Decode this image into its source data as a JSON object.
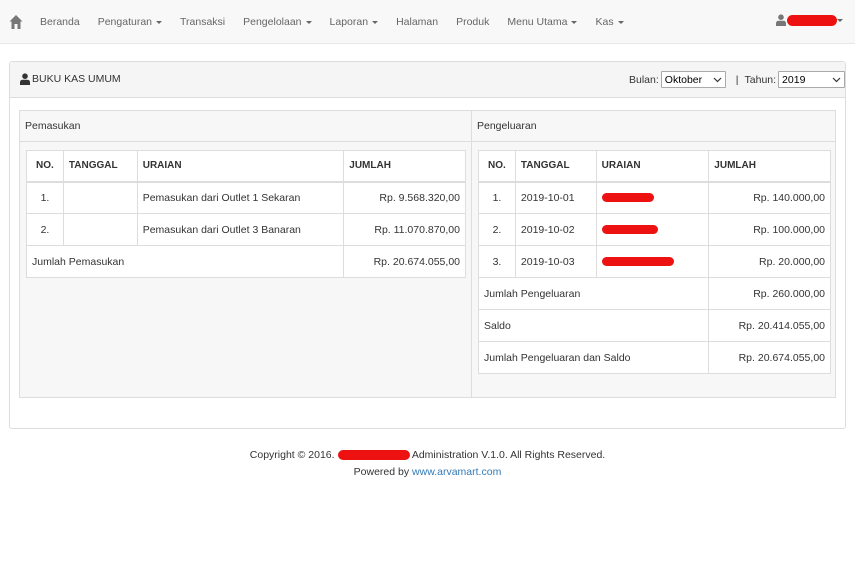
{
  "navbar": {
    "items": [
      {
        "label": "Beranda",
        "dropdown": false
      },
      {
        "label": "Pengaturan",
        "dropdown": true
      },
      {
        "label": "Transaksi",
        "dropdown": false
      },
      {
        "label": "Pengelolaan",
        "dropdown": true
      },
      {
        "label": "Laporan",
        "dropdown": true
      },
      {
        "label": "Halaman",
        "dropdown": false
      },
      {
        "label": "Produk",
        "dropdown": false
      },
      {
        "label": "Menu Utama",
        "dropdown": true
      },
      {
        "label": "Kas",
        "dropdown": true
      }
    ]
  },
  "panel": {
    "title": "BUKU KAS UMUM",
    "bulan_label": "Bulan:",
    "bulan_value": "Oktober",
    "separator": "|",
    "tahun_label": "Tahun:",
    "tahun_value": "2019"
  },
  "pemasukan": {
    "heading": "Pemasukan",
    "columns": [
      "NO.",
      "TANGGAL",
      "URAIAN",
      "JUMLAH"
    ],
    "rows": [
      {
        "no": "1.",
        "tanggal": "",
        "uraian": "Pemasukan dari Outlet 1 Sekaran",
        "jumlah": "Rp. 9.568.320,00"
      },
      {
        "no": "2.",
        "tanggal": "",
        "uraian": "Pemasukan dari Outlet 3 Banaran",
        "jumlah": "Rp. 11.070.870,00"
      }
    ],
    "total_label": "Jumlah Pemasukan",
    "total_value": "Rp. 20.674.055,00"
  },
  "pengeluaran": {
    "heading": "Pengeluaran",
    "columns": [
      "NO.",
      "TANGGAL",
      "URAIAN",
      "JUMLAH"
    ],
    "rows": [
      {
        "no": "1.",
        "tanggal": "2019-10-01",
        "uraian": "",
        "jumlah": "Rp. 140.000,00"
      },
      {
        "no": "2.",
        "tanggal": "2019-10-02",
        "uraian": "",
        "jumlah": "Rp. 100.000,00"
      },
      {
        "no": "3.",
        "tanggal": "2019-10-03",
        "uraian": "",
        "jumlah": "Rp. 20.000,00"
      }
    ],
    "summary": [
      {
        "label": "Jumlah Pengeluaran",
        "value": "Rp. 260.000,00"
      },
      {
        "label": "Saldo",
        "value": "Rp. 20.414.055,00"
      },
      {
        "label": "Jumlah Pengeluaran dan Saldo",
        "value": "Rp. 20.674.055,00"
      }
    ]
  },
  "footer": {
    "copyright_prefix": "Copyright © 2016.",
    "copyright_suffix": "Administration V.1.0. All Rights Reserved.",
    "powered_prefix": "Powered by",
    "powered_link": "www.arvamart.com"
  },
  "colors": {
    "navbar_bg": "#f8f8f8",
    "link": "#337ab7",
    "redaction": "#ee1111"
  },
  "icons": {
    "home": "home-icon",
    "user": "user-icon"
  }
}
